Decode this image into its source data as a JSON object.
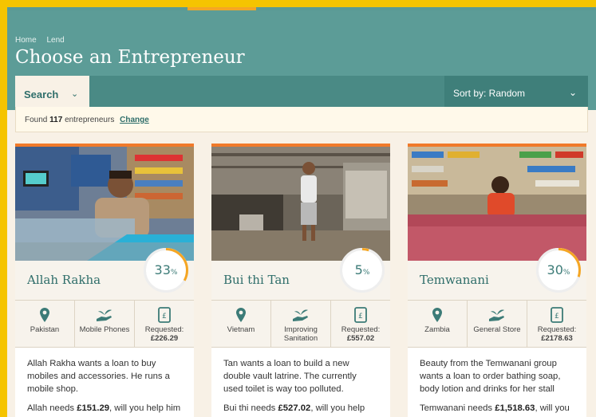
{
  "breadcrumb": [
    "Home",
    "Lend"
  ],
  "title": "Choose an Entrepreneur",
  "search": {
    "label": "Search",
    "chevron": "⌄"
  },
  "sort": {
    "label": "Sort by: Random",
    "chevron": "⌄"
  },
  "found": {
    "prefix": "Found",
    "count": "117",
    "suffix": "entrepreneurs",
    "change": "Change"
  },
  "cards": [
    {
      "name": "Allah Rakha",
      "percent": 33,
      "percent_label": "33",
      "country": "Pakistan",
      "sector": "Mobile Phones",
      "requested_label": "Requested:",
      "requested": "£226.29",
      "desc1": "Allah Rakha wants a loan to buy mobiles and accessories. He runs a mobile shop.",
      "needs_prefix": "Allah needs",
      "needs_amount": "£151.29",
      "needs_suffix": ", will you help him reach his target?"
    },
    {
      "name": "Bui thi Tan",
      "percent": 5,
      "percent_label": "5",
      "country": "Vietnam",
      "sector": "Improving Sanitation",
      "requested_label": "Requested:",
      "requested": "£557.02",
      "desc1": "Tan wants a loan to build a new double vault latrine. The currently used toilet is way too polluted.",
      "needs_prefix": "Bui thi needs",
      "needs_amount": "£527.02",
      "needs_suffix": ", will you help her reach her target?"
    },
    {
      "name": "Temwanani",
      "percent": 30,
      "percent_label": "30",
      "country": "Zambia",
      "sector": "General Store",
      "requested_label": "Requested:",
      "requested": "£2178.63",
      "desc1": "Beauty from the Temwanani group wants a loan to order bathing soap, body lotion and drinks for her stall",
      "needs_prefix": "Temwanani needs",
      "needs_amount": "£1,518.63",
      "needs_suffix": ", will you help them reach their target?"
    }
  ],
  "percent_sign": "%",
  "colors": {
    "header": "#5c9c97",
    "accent": "#f07a2a",
    "teal_text": "#2f6e6a",
    "frame": "#f5c400"
  },
  "icons": [
    "location-pin-icon",
    "sector-hand-plant-icon",
    "pound-document-icon",
    "chevron-down-icon"
  ]
}
